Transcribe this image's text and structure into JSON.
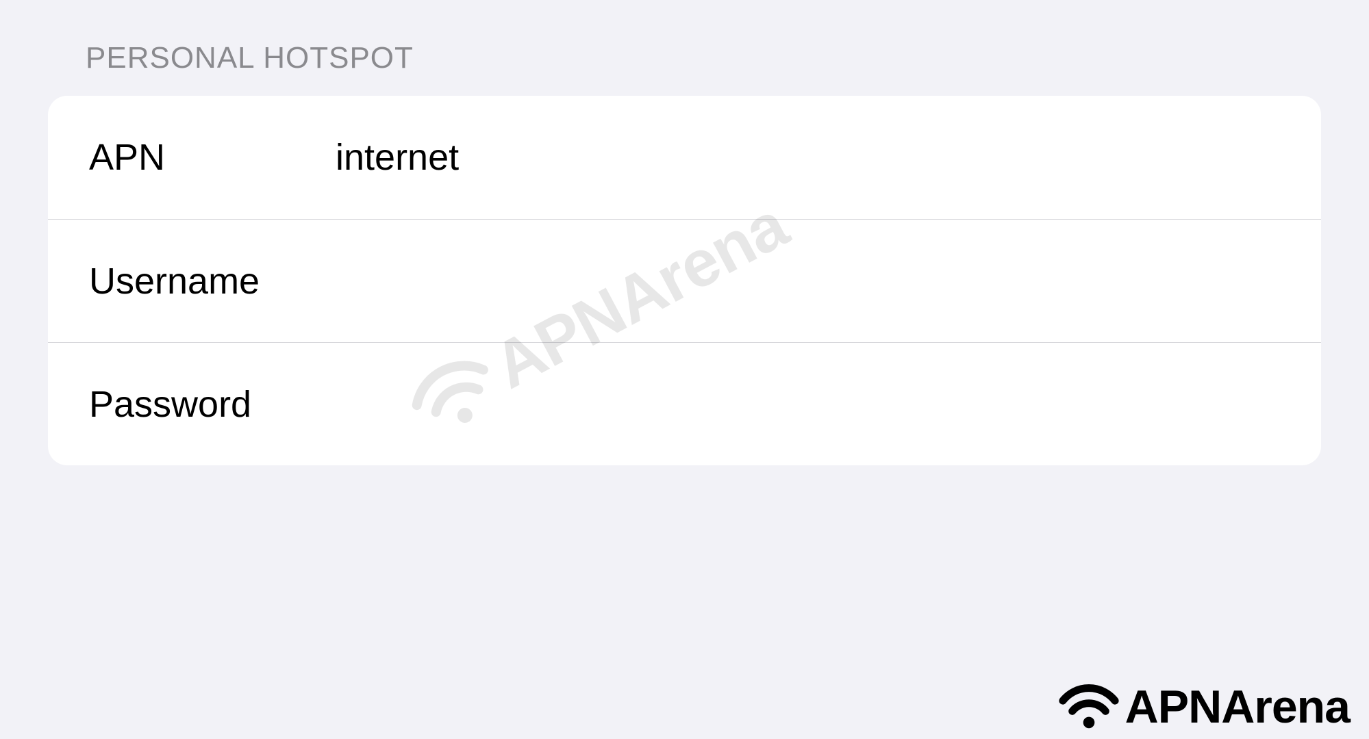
{
  "section": {
    "header": "PERSONAL HOTSPOT",
    "rows": [
      {
        "label": "APN",
        "value": "internet"
      },
      {
        "label": "Username",
        "value": ""
      },
      {
        "label": "Password",
        "value": ""
      }
    ]
  },
  "watermark": "APNArena",
  "brand": "APNArena"
}
